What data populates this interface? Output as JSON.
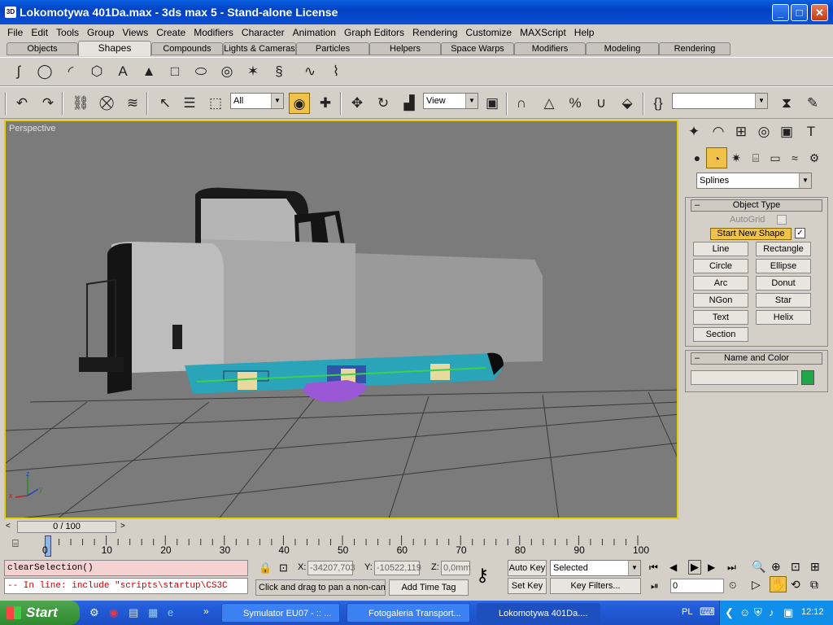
{
  "window": {
    "title": "Lokomotywa 401Da.max - 3ds max 5 - Stand-alone License",
    "app_icon": "3ds-max-icon",
    "minimize": "_",
    "maximize": "□",
    "close": "✕"
  },
  "menu": [
    "File",
    "Edit",
    "Tools",
    "Group",
    "Views",
    "Create",
    "Modifiers",
    "Character",
    "Animation",
    "Graph Editors",
    "Rendering",
    "Customize",
    "MAXScript",
    "Help"
  ],
  "tabs": [
    "Objects",
    "Shapes",
    "Compounds",
    "Lights & Cameras",
    "Particles",
    "Helpers",
    "Space Warps",
    "Modifiers",
    "Modeling",
    "Rendering"
  ],
  "active_tab": "Shapes",
  "toolbar": {
    "selection_filter": "All",
    "ref_coord": "View",
    "named_selection": ""
  },
  "viewport": {
    "label": "Perspective",
    "axis_z": "z",
    "axis_x": "x",
    "axis_y": "y"
  },
  "command_panel": {
    "category": "Splines",
    "object_type": {
      "title": "Object Type",
      "autogrid": "AutoGrid",
      "start_new_shape": "Start New Shape",
      "buttons": [
        "Line",
        "Rectangle",
        "Circle",
        "Ellipse",
        "Arc",
        "Donut",
        "NGon",
        "Star",
        "Text",
        "Helix",
        "Section"
      ]
    },
    "name_color": {
      "title": "Name and Color",
      "name_value": "",
      "color": "#22a64a"
    }
  },
  "timeline": {
    "frame_label": "0 / 100",
    "ticks": [
      "0",
      "10",
      "20",
      "30",
      "40",
      "50",
      "60",
      "70",
      "80",
      "90",
      "100"
    ]
  },
  "status": {
    "listener_line1": "clearSelection()",
    "listener_line2": "-- In line: include \"scripts\\startup\\CS3C",
    "x_label": "X:",
    "x_value": "-34207,703",
    "y_label": "Y:",
    "y_value": "-10522,119",
    "z_label": "Z:",
    "z_value": "0,0mm",
    "prompt": "Click and drag to pan a non-cam",
    "add_time_tag": "Add Time Tag",
    "auto_key": "Auto Key",
    "set_key": "Set Key",
    "key_mode": "Selected",
    "key_filters": "Key Filters...",
    "current_frame": "0"
  },
  "taskbar": {
    "start": "Start",
    "tasks": [
      "Symulator EU07 - :: ...",
      "Fotogaleria Transport...",
      "Lokomotywa 401Da...."
    ],
    "language": "PL",
    "clock": "12:12"
  }
}
